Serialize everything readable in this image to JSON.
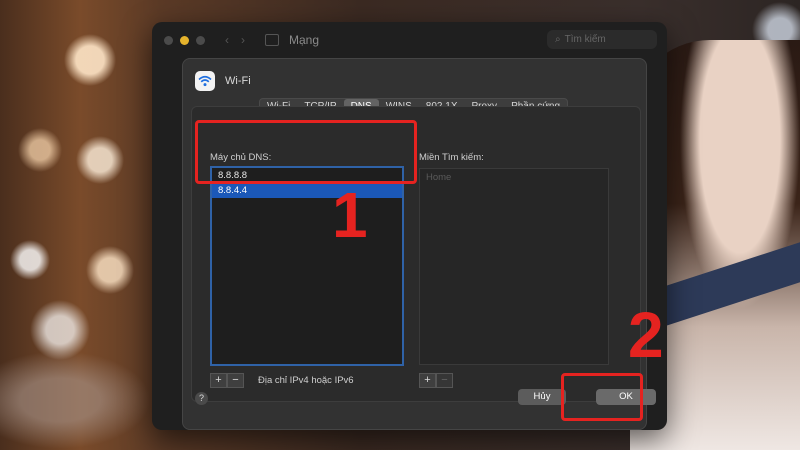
{
  "window": {
    "title": "Mạng",
    "search_placeholder": "Tìm kiếm"
  },
  "sheet": {
    "title": "Wi-Fi",
    "tabs": [
      {
        "label": "Wi-Fi",
        "active": false
      },
      {
        "label": "TCP/IP",
        "active": false
      },
      {
        "label": "DNS",
        "active": true
      },
      {
        "label": "WINS",
        "active": false
      },
      {
        "label": "802.1X",
        "active": false
      },
      {
        "label": "Proxy",
        "active": false
      },
      {
        "label": "Phần cứng",
        "active": false
      }
    ],
    "dns_servers_label": "Máy chủ DNS:",
    "dns_servers": [
      "8.8.8.8",
      "8.8.4.4"
    ],
    "search_domains_label": "Miền Tìm kiếm:",
    "search_domains_placeholder": "Home",
    "add_symbol": "+",
    "remove_symbol": "−",
    "hint": "Địa chỉ IPv4 hoặc IPv6",
    "help_symbol": "?",
    "cancel_label": "Hủy",
    "ok_label": "OK"
  },
  "annotations": {
    "step1": "1",
    "step2": "2",
    "color": "#e52320"
  }
}
